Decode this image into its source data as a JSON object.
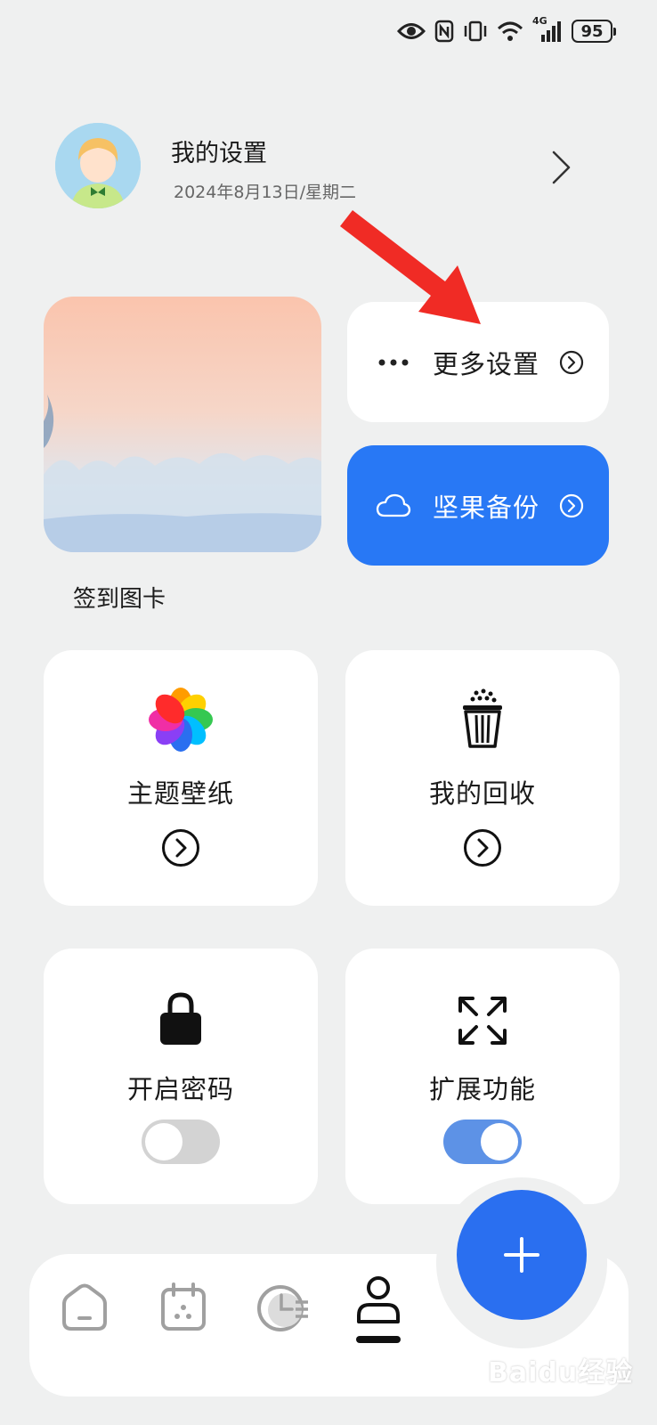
{
  "status_bar": {
    "network_label": "4G",
    "battery_level": "95"
  },
  "profile": {
    "title": "我的设置",
    "date": "2024年8月13日/星期二"
  },
  "cards": {
    "checkin_label": "签到图卡",
    "more_settings_label": "更多设置",
    "backup_label": "坚果备份"
  },
  "tiles": {
    "theme_label": "主题壁纸",
    "recycle_label": "我的回收",
    "password_label": "开启密码",
    "password_enabled": false,
    "extend_label": "扩展功能",
    "extend_enabled": true
  },
  "bottom_nav": {
    "items": [
      "home",
      "calendar",
      "stats",
      "profile"
    ],
    "active": "profile"
  },
  "watermark": "Baidu经验",
  "colors": {
    "background": "#eff0f0",
    "accent_blue": "#2878f5",
    "fab_blue": "#2a6ff0",
    "toggle_on": "#5d92e6",
    "arrow_red": "#f02b25"
  }
}
